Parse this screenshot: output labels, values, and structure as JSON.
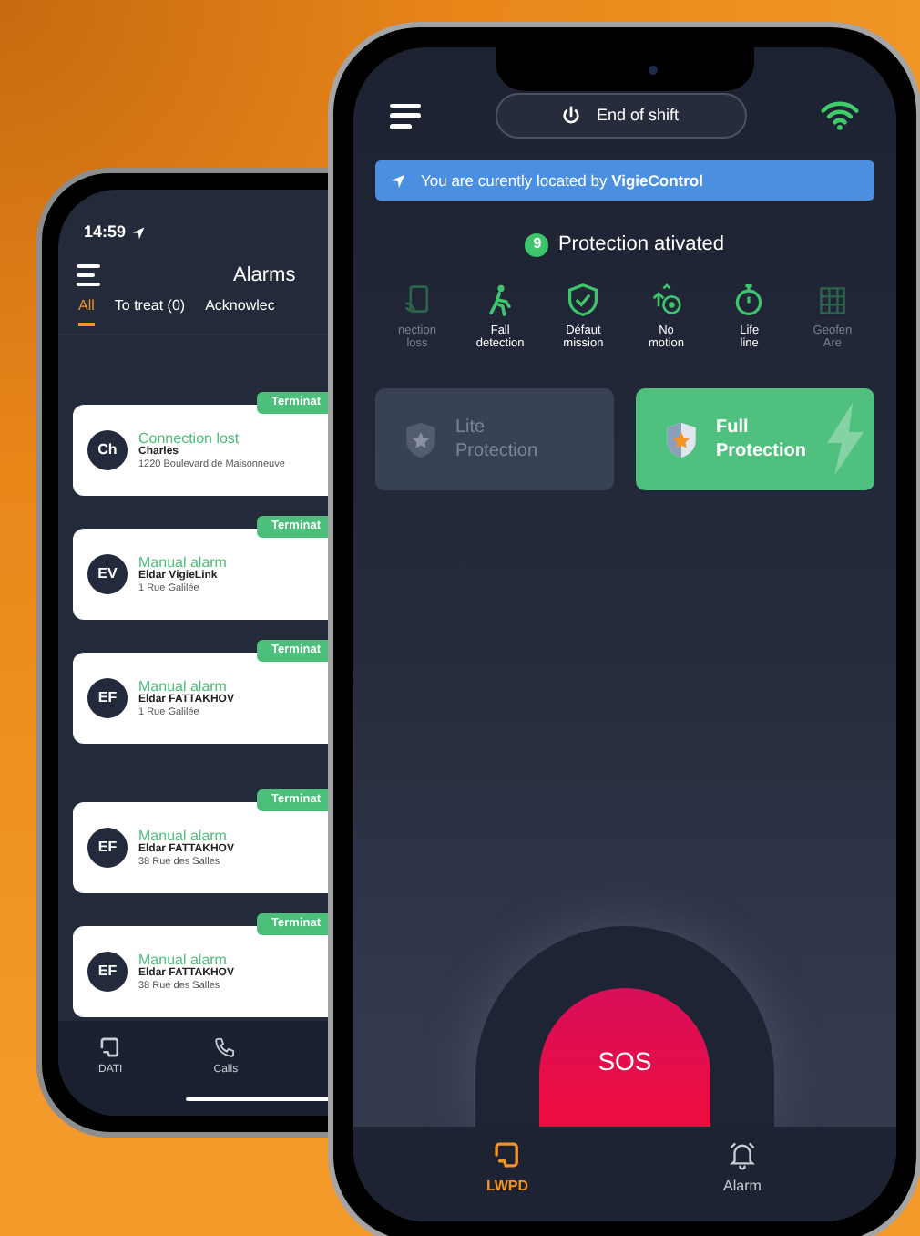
{
  "back_phone": {
    "status_time": "14:59",
    "title": "Alarms",
    "tabs": [
      {
        "label": "All",
        "selected": true
      },
      {
        "label": "To treat (0)",
        "selected": false
      },
      {
        "label": "Acknowlec",
        "selected": false
      }
    ],
    "alarms": [
      {
        "initials": "Ch",
        "type": "Connection lost",
        "name": "Charles",
        "address": "1220 Boulevard de Maisonneuve",
        "badge": "Terminat"
      },
      {
        "initials": "EV",
        "type": "Manual alarm",
        "name": "Eldar VigieLink",
        "address": "1 Rue Galilée",
        "badge": "Terminat"
      },
      {
        "initials": "EF",
        "type": "Manual alarm",
        "name": "Eldar FATTAKHOV",
        "address": "1 Rue Galilée",
        "badge": "Terminat"
      },
      {
        "initials": "EF",
        "type": "Manual alarm",
        "name": "Eldar FATTAKHOV",
        "address": "38 Rue des Salles",
        "badge": "Terminat"
      },
      {
        "initials": "EF",
        "type": "Manual alarm",
        "name": "Eldar FATTAKHOV",
        "address": "38 Rue des Salles",
        "badge": "Terminat"
      }
    ],
    "nav": [
      {
        "label": "DATI",
        "kind": "device",
        "selected": false
      },
      {
        "label": "Calls",
        "kind": "phone",
        "selected": false
      }
    ]
  },
  "front_phone": {
    "shift_button": "End of shift",
    "location_banner": "You are curently located by **VigieControl**",
    "protection_count": "9",
    "protection_status": "Protection ativated",
    "features": [
      {
        "kind": "connection",
        "label": "nection\nloss",
        "faded": true
      },
      {
        "kind": "fall",
        "label": "Fall\ndetection",
        "faded": false
      },
      {
        "kind": "mission",
        "label": "Défaut\nmission",
        "faded": false
      },
      {
        "kind": "motion",
        "label": "No\nmotion",
        "faded": false
      },
      {
        "kind": "timer",
        "label": "Life\nline",
        "faded": false
      },
      {
        "kind": "geofence",
        "label": "Geofen\nAre",
        "faded": true
      }
    ],
    "modes": [
      {
        "label": "Lite Protection",
        "selected": false
      },
      {
        "label": "Full Protection",
        "selected": true
      }
    ],
    "sos": "SOS",
    "nav": [
      {
        "label": "LWPD",
        "kind": "device",
        "selected": true
      },
      {
        "label": "Alarm",
        "kind": "bell",
        "selected": false
      }
    ]
  }
}
